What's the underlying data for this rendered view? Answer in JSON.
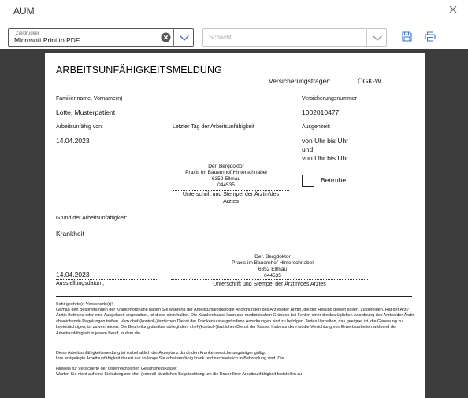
{
  "window": {
    "title": "AUM"
  },
  "toolbar": {
    "printer": {
      "label": "Zieldrucker",
      "value": "Microsoft Print to PDF"
    },
    "tray": {
      "placeholder": "Schacht"
    }
  },
  "colors": {
    "accent": "#3a6fc0",
    "preview_bg": "#3c3c3c"
  },
  "icons": {
    "save": "save-icon",
    "print": "printer-icon",
    "clear": "clear-icon",
    "dropdown": "chevron-down-icon",
    "close": "close-icon"
  },
  "document": {
    "title": "ARBEITSUNFÄHIGKEITSMELDUNG",
    "insurer_label": "Versicherungsträger:",
    "insurer_value": "ÖGK-W",
    "name_label": "Familienname, Vorname(n)",
    "name_value": "Lotte, Musterpatient",
    "insno_label": "Versicherungsnummer",
    "insno_value": "1002010477",
    "unfit_label": "Arbeitsunfähig von:",
    "unfit_value": "14.04.2023",
    "last_day_label": "Letzter Tag der Arbeitsunfähigkeit",
    "outing_label": "Ausgehzeit:",
    "outing_row1": "von  Uhr bis  Uhr",
    "outing_and": "und",
    "outing_row2": "von  Uhr bis  Uhr",
    "bedrest_label": "Bettruhe",
    "stamp1": {
      "line1": "Der. Bergdoktor",
      "line2": "Praxis im Bauernhof Hinterschnabel",
      "line3": "6352 Ellmau",
      "line4": "044535"
    },
    "sig1_caption_1": "Unterschrift und Stempel der Ärztin/des",
    "sig1_caption_2": "Arztes",
    "reason_label": "Grund der Arbeitsunfähigkeit:",
    "reason_value": "Krankheit",
    "stamp2": {
      "line1": "Der. Bergdoktor",
      "line2": "Praxis im Bauernhof Hinterschnabel",
      "line3": "6352 Ellmau",
      "line4": "044535"
    },
    "issue_date_value": "14.04.2023",
    "issue_date_label": "Ausstellungsdatum,",
    "sig2_caption": "Unterschrift und Stempel der Ärztin/des Arztes",
    "salutation": "Sehr geehrte(r) Versicherte(r)!",
    "para1": "Gemäß den Bestimmungen der Krankenordnung haben Sie während der Arbeitsunfähigkeit die Anordnungen des Arztes/der Ärztin, die der Heilung dienen sollen, zu befolgen. Hat der Arzt/Ärztin Bettruhe oder eine Ausgehzeit angeordnet, ist diese einzuhalten. Die Krankenkasse kann aus medizinischen Gründen bei Fehlen einer diesbezüglichen Anordnung des Arztes/der Ärztin abweichende Regelungen treffen. Vom chef-(kontroll-)ärztlichen Dienst der Krankenkasse getroffene Anordnungen sind zu befolgen. Jedes Verhalten, das geeignet ist, die Genesung zu beeinträchtigen, ist zu vermeiden. Die Beurteilung darüber obliegt dem chef-(kontroll-)ärztlichen Dienst der Kasse. Insbesondere ist die Verrichtung von Erwerbsarbeiten während der Arbeitsunfähigkeit in jenem Beruf, in dem die",
    "para2_1": "Diese Arbeitsunfähigkeitsmeldung ist vorbehaltlich der Akzeptanz durch den Krankenversicherungsträger gültig.",
    "para2_2": "Ihre festgelegte Arbeitsunfähigkeit dauert nur so lange Sie arbeitsunfähig krank und nachweislich in Behandlung sind. Die",
    "para3_1": "Hinweis für Versicherte der Österreichischen Gesundheitskasse:",
    "para3_2": "Warten Sie nicht auf eine Einladung zur chef-(kontroll-)ärztlichen Begutachtung um die Dauer Ihrer Arbeitsunfähigkeit feststellen zu"
  }
}
